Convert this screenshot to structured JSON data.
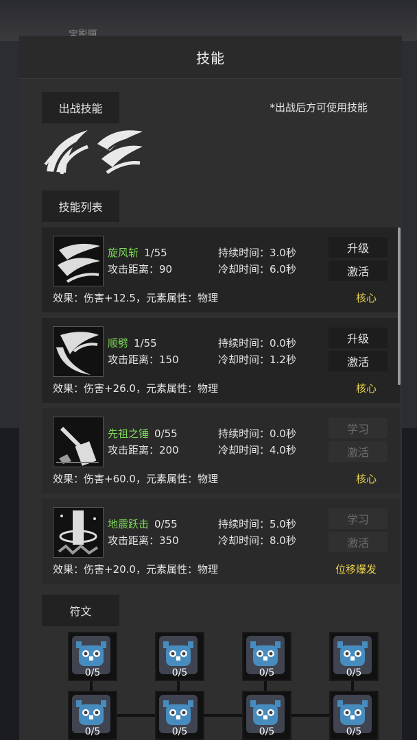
{
  "background": {
    "status_text": "宝影匣"
  },
  "dialog": {
    "title": "技能"
  },
  "battle_section": {
    "label": "出战技能",
    "hint": "*出战后方可使用技能",
    "equipped_icons": [
      "whirlwind-slash-icon",
      "wave-slash-icon"
    ]
  },
  "list_section": {
    "label": "技能列表"
  },
  "skills": [
    {
      "icon": "whirlwind-slash-icon",
      "name": "旋风斩",
      "level": "1/55",
      "range": "攻击距离：90",
      "duration": "持续时间：3.0秒",
      "cooldown": "冷却时间：6.0秒",
      "effect": "效果：伤害+12.5，元素属性：物理",
      "tag": "核心",
      "primary_action": "升级",
      "secondary_action": "激活",
      "locked": false
    },
    {
      "icon": "split-slash-icon",
      "name": "顺劈",
      "level": "1/55",
      "range": "攻击距离：150",
      "duration": "持续时间：0.0秒",
      "cooldown": "冷却时间：1.2秒",
      "effect": "效果：伤害+26.0，元素属性：物理",
      "tag": "核心",
      "primary_action": "升级",
      "secondary_action": "激活",
      "locked": false
    },
    {
      "icon": "hammer-icon",
      "name": "先祖之锤",
      "level": "0/55",
      "range": "攻击距离：200",
      "duration": "持续时间：0.0秒",
      "cooldown": "冷却时间：4.0秒",
      "effect": "效果：伤害+60.0，元素属性：物理",
      "tag": "核心",
      "primary_action": "学习",
      "secondary_action": "激活",
      "locked": true
    },
    {
      "icon": "earthquake-leap-icon",
      "name": "地震跃击",
      "level": "0/55",
      "range": "攻击距离：350",
      "duration": "持续时间：5.0秒",
      "cooldown": "冷却时间：8.0秒",
      "effect": "效果：伤害+20.0，元素属性：物理",
      "tag": "位移爆发",
      "primary_action": "学习",
      "secondary_action": "激活",
      "locked": true
    }
  ],
  "rune_section": {
    "label": "符文",
    "nodes": [
      {
        "icon": "godot-icon",
        "count": "0/5"
      },
      {
        "icon": "godot-icon",
        "count": "0/5"
      },
      {
        "icon": "godot-icon",
        "count": "0/5"
      },
      {
        "icon": "godot-icon",
        "count": "0/5"
      },
      {
        "icon": "godot-icon",
        "count": "0/5"
      },
      {
        "icon": "godot-icon",
        "count": "0/5"
      },
      {
        "icon": "godot-icon",
        "count": "0/5"
      },
      {
        "icon": "godot-icon",
        "count": "0/5"
      }
    ]
  },
  "colors": {
    "skill_name": "#7ed957",
    "tag": "#e8d24b",
    "panel": "#2f2f2f",
    "card": "#242424"
  }
}
